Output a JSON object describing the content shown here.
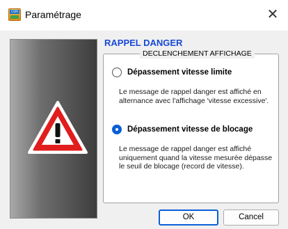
{
  "window": {
    "title": "Paramétrage",
    "close_glyph": "✕",
    "app_icon_text": "COM"
  },
  "dialog": {
    "heading": "RAPPEL DANGER",
    "heading_color": "#1848d4",
    "group_title": "DECLENCHEMENT AFFICHAGE",
    "sidebar_icon": "warning-triangle-icon",
    "options": [
      {
        "label": "Dépassement vitesse limite",
        "checked": false,
        "description": "Le message de rappel danger est affiché en alternance avec l'affichage 'vitesse excessive'."
      },
      {
        "label": "Dépassement vitesse de blocage",
        "checked": true,
        "description": "Le message de rappel danger est affiché uniquement quand la vitesse mesurée dépasse le seuil de blocage (record de vitesse)."
      }
    ]
  },
  "buttons": {
    "ok": "OK",
    "cancel": "Cancel",
    "accent_color": "#0a5fd6"
  }
}
